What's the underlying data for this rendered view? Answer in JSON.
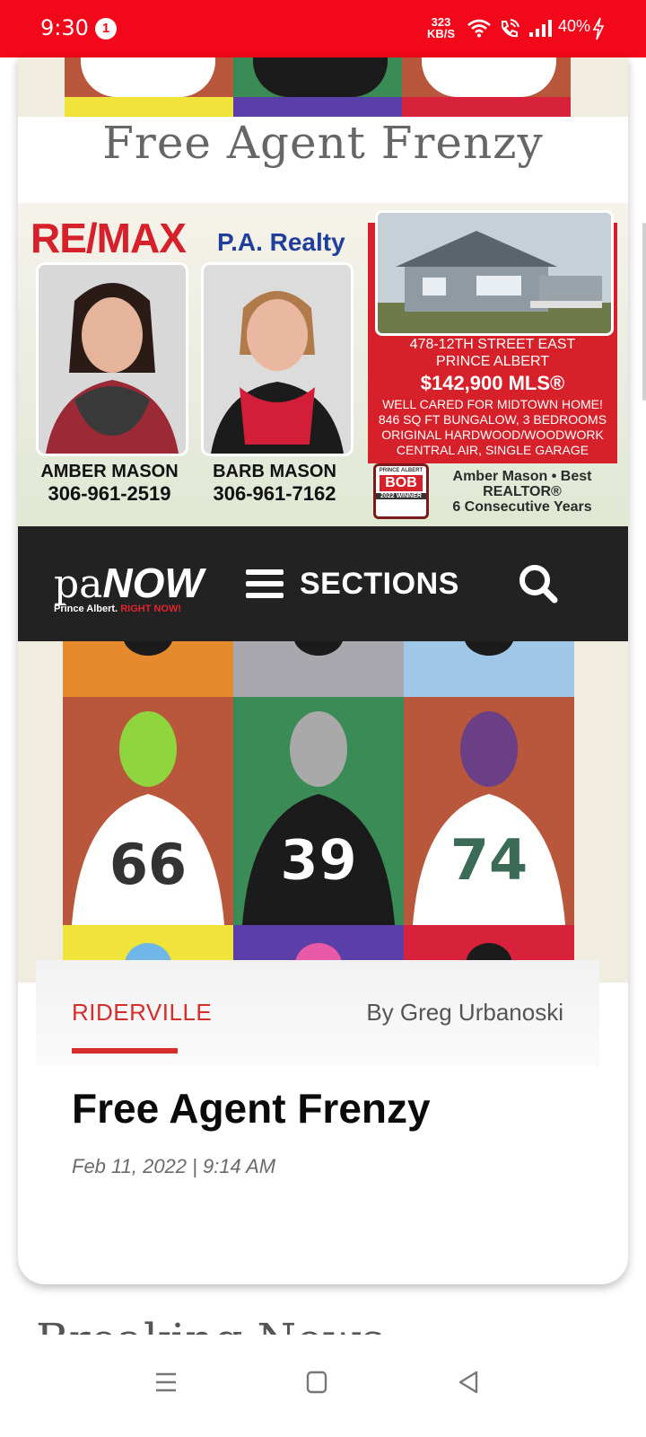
{
  "status_bar": {
    "time": "9:30",
    "notification_count": "1",
    "net_speed_value": "323",
    "net_speed_unit": "KB/S",
    "battery": "40%"
  },
  "top_article": {
    "title": "Free Agent Frenzy"
  },
  "ad": {
    "brand": "RE/MAX",
    "brand_sub": "P.A. Realty",
    "agents": [
      {
        "name": "AMBER MASON",
        "phone": "306-961-2519"
      },
      {
        "name": "BARB MASON",
        "phone": "306-961-7162"
      }
    ],
    "listing": {
      "address_line1": "478-12TH STREET EAST",
      "address_line2": "PRINCE ALBERT",
      "price": "$142,900 MLS®",
      "desc1": "WELL CARED FOR MIDTOWN HOME!",
      "desc2": "846 SQ FT BUNGALOW, 3 BEDROOMS",
      "desc3": "ORIGINAL HARDWOOD/WOODWORK",
      "desc4": "CENTRAL AIR, SINGLE GARAGE"
    },
    "badge_top": "PRINCE ALBERT",
    "badge_main": "BOB",
    "badge_winner": "2022 WINNER",
    "best_line1": "Amber Mason • Best REALTOR®",
    "best_line2": "6 Consecutive Years"
  },
  "nav": {
    "logo_pa": "pa",
    "logo_now": "NOW",
    "logo_tag_white": "Prince Albert.",
    "logo_tag_red": "RIGHT NOW!",
    "sections_label": "SECTIONS"
  },
  "hero": {
    "jersey_numbers": [
      "66",
      "39",
      "74"
    ]
  },
  "article": {
    "category": "RIDERVILLE",
    "author": "By Greg Urbanoski",
    "title": "Free Agent Frenzy",
    "date": "Feb 11, 2022 | 9:14 AM"
  },
  "next_section": {
    "title": "Breaking News"
  },
  "colors": {
    "status_bar": "#f2071b",
    "accent_red": "#d62d2d",
    "nav_bg": "#222222"
  }
}
